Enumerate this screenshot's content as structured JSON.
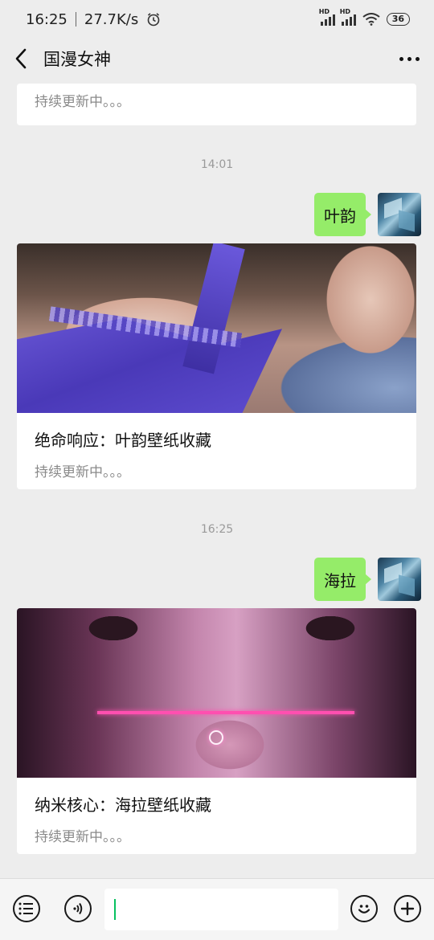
{
  "status_bar": {
    "time": "16:25",
    "network_speed": "27.7K/s",
    "signal_label": "HD",
    "battery": "36"
  },
  "header": {
    "title": "国漫女神"
  },
  "messages": {
    "top_card": {
      "subtitle": "持续更新中。。。"
    },
    "timestamp_1": "14:01",
    "user_msg_1": "叶韵",
    "card_1": {
      "title": "绝命响应：叶韵壁纸收藏",
      "subtitle": "持续更新中。。。"
    },
    "timestamp_2": "16:25",
    "user_msg_2": "海拉",
    "card_2": {
      "title": "纳米核心：海拉壁纸收藏",
      "subtitle": "持续更新中。。。"
    }
  },
  "icons": {
    "back": "chevron-left-icon",
    "more": "more-dots-icon",
    "menu": "list-menu-icon",
    "voice": "voice-icon",
    "emoji": "emoji-icon",
    "add": "plus-icon"
  },
  "colors": {
    "bubble": "#95ec69",
    "background": "#ededed",
    "caret": "#07c160"
  }
}
